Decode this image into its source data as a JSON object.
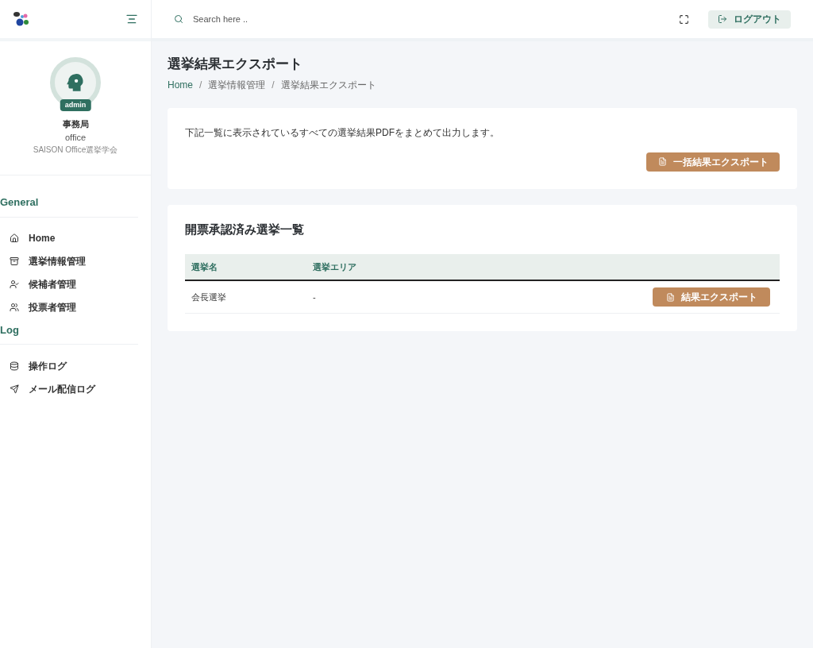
{
  "header": {
    "search": {
      "placeholder": "Search here .."
    },
    "logout_label": "ログアウト"
  },
  "profile": {
    "badge": "admin",
    "name": "事務局",
    "role": "office",
    "organization": "SAISON Office選挙学会"
  },
  "sidebar": {
    "sections": [
      {
        "title": "General",
        "items": [
          "Home",
          "選挙情報管理",
          "候補者管理",
          "投票者管理"
        ]
      },
      {
        "title": "Log",
        "items": [
          "操作ログ",
          "メール配信ログ"
        ]
      }
    ]
  },
  "page": {
    "title": "選挙結果エクスポート",
    "breadcrumb_separator": "/",
    "breadcrumb": [
      "Home",
      "選挙情報管理",
      "選挙結果エクスポート"
    ]
  },
  "export_card": {
    "description": "下記一覧に表示されているすべての選挙結果PDFをまとめて出力します。",
    "button": "一括結果エクスポート"
  },
  "table_card": {
    "title": "開票承認済み選挙一覧",
    "columns": [
      "選挙名",
      "選挙エリア"
    ],
    "rows": [
      {
        "name": "会長選挙",
        "area": "-",
        "button": "結果エクスポート"
      }
    ]
  }
}
